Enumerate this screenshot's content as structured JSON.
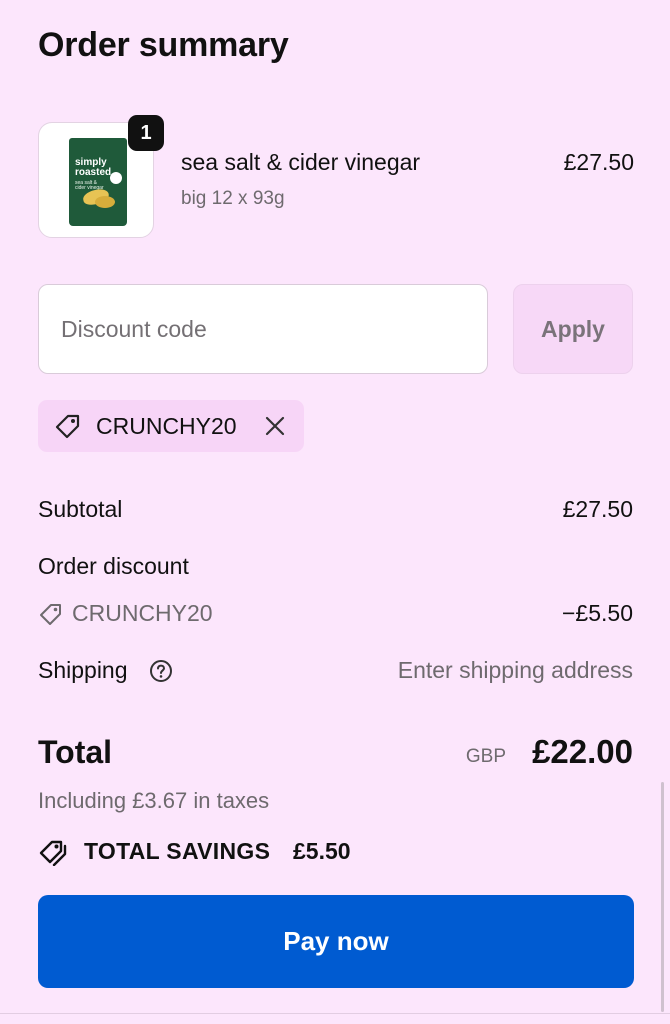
{
  "summary": {
    "title": "Order summary"
  },
  "product": {
    "quantity": "1",
    "name": "sea salt & cider vinegar",
    "variant": "big 12 x 93g",
    "price": "£27.50",
    "brand_text": "simply roasted.",
    "brand_color": "#1f5a3a"
  },
  "discount": {
    "placeholder": "Discount code",
    "value": "",
    "apply_label": "Apply",
    "applied_code": "CRUNCHY20"
  },
  "totals": {
    "subtotal_label": "Subtotal",
    "subtotal_value": "£27.50",
    "order_discount_label": "Order discount",
    "discount_code": "CRUNCHY20",
    "discount_value": "−£5.50",
    "shipping_label": "Shipping",
    "shipping_value": "Enter shipping address",
    "total_label": "Total",
    "currency": "GBP",
    "total_value": "£22.00",
    "taxes_note": "Including £3.67 in taxes",
    "savings_label": "TOTAL SAVINGS",
    "savings_value": "£5.50"
  },
  "actions": {
    "pay_label": "Pay now"
  },
  "colors": {
    "background": "#fce6fc",
    "primary": "#005bd1",
    "chip": "#f7d5f7"
  }
}
